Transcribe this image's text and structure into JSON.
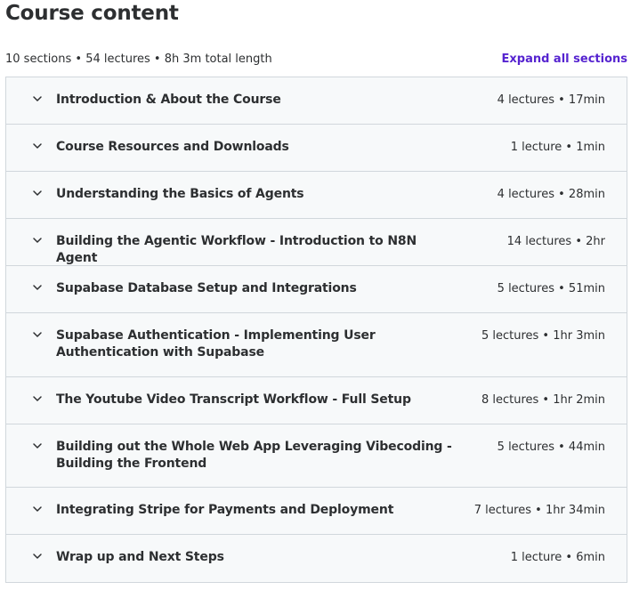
{
  "header": {
    "title": "Course content",
    "summary": "10 sections • 54 lectures • 8h 3m total length",
    "expand_label": "Expand all sections"
  },
  "sections": [
    {
      "title": "Introduction & About the Course",
      "meta": "4 lectures • 17min"
    },
    {
      "title": "Course Resources and Downloads",
      "meta": "1 lecture • 1min"
    },
    {
      "title": "Understanding the Basics of Agents",
      "meta": "4 lectures • 28min"
    },
    {
      "title": "Building the Agentic Workflow - Introduction to N8N Agent",
      "meta": "14 lectures • 2hr"
    },
    {
      "title": "Supabase Database Setup and Integrations",
      "meta": "5 lectures • 51min"
    },
    {
      "title": "Supabase Authentication - Implementing User Authentication with Supabase",
      "meta": "5 lectures • 1hr 3min"
    },
    {
      "title": "The Youtube Video Transcript Workflow - Full Setup",
      "meta": "8 lectures • 1hr 2min"
    },
    {
      "title": "Building out the Whole Web App Leveraging Vibecoding - Building the Frontend",
      "meta": "5 lectures • 44min"
    },
    {
      "title": "Integrating Stripe for Payments and Deployment",
      "meta": "7 lectures • 1hr 34min"
    },
    {
      "title": "Wrap up and Next Steps",
      "meta": "1 lecture • 6min"
    }
  ],
  "icons": {
    "section_toggle": "chevron-down-icon"
  },
  "colors": {
    "text": "#2d2f31",
    "link": "#5624d0",
    "row_bg": "#f7f9fa",
    "border": "#d1d7dc"
  }
}
